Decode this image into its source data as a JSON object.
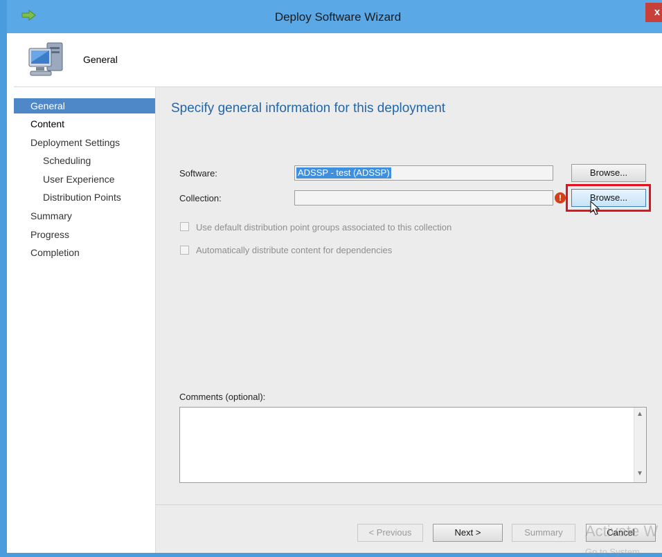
{
  "window": {
    "title": "Deploy Software Wizard",
    "close_label": "x"
  },
  "header": {
    "title": "General"
  },
  "nav": {
    "items": [
      {
        "label": "General"
      },
      {
        "label": "Content"
      },
      {
        "label": "Deployment Settings"
      },
      {
        "label": "Scheduling"
      },
      {
        "label": "User Experience"
      },
      {
        "label": "Distribution Points"
      },
      {
        "label": "Summary"
      },
      {
        "label": "Progress"
      },
      {
        "label": "Completion"
      }
    ]
  },
  "main": {
    "title": "Specify general information for this deployment",
    "software_label": "Software:",
    "software_value": "ADSSP - test (ADSSP)",
    "collection_label": "Collection:",
    "collection_value": "",
    "browse_label": "Browse...",
    "checkbox_default_dp": "Use default distribution point groups associated to this collection",
    "checkbox_dependencies": "Automatically distribute content for dependencies",
    "comments_label": "Comments (optional):",
    "comments_value": ""
  },
  "footer": {
    "previous_label": "< Previous",
    "next_label": "Next >",
    "summary_label": "Summary",
    "cancel_label": "Cancel"
  },
  "watermark": {
    "line1": "Activate W",
    "line2": "Go to System"
  },
  "colors": {
    "titlebar": "#5ba8e6",
    "selection": "#4e88c8",
    "heading": "#2266aa",
    "highlight": "#e0141e"
  }
}
